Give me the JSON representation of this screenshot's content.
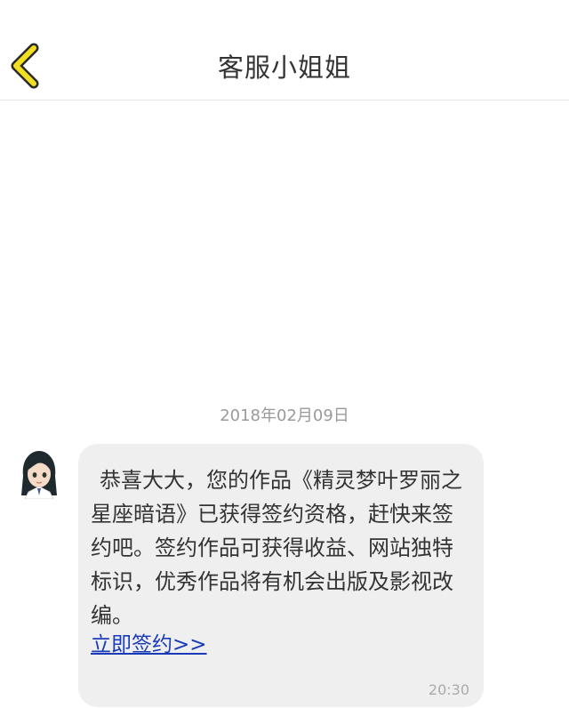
{
  "nav": {
    "title": "客服小姐姐",
    "back_icon": "chevron-left-icon",
    "accent_color": "#f2e020"
  },
  "chat": {
    "date": "2018年02月09日",
    "message": {
      "text": "恭喜大大，您的作品《精灵梦叶罗丽之星座暗语》已获得签约资格，赶快来签约吧。签约作品可获得收益、网站独特标识，优秀作品将有机会出版及影视改编。",
      "link_label": "立即签约>> ",
      "time": "20:30"
    },
    "avatar_icon": "customer-service-avatar"
  }
}
